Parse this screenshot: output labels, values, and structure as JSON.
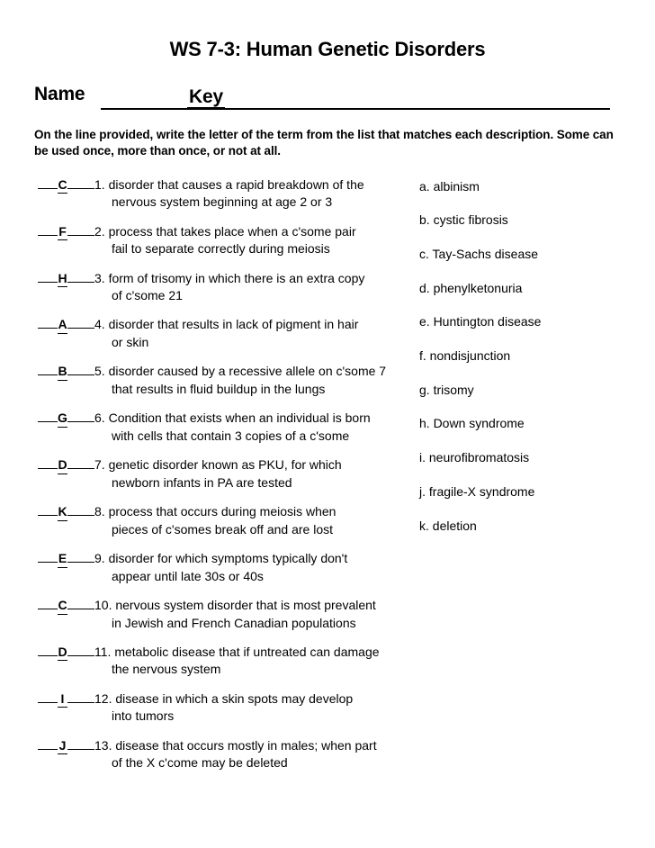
{
  "document": {
    "title": "WS 7-3: Human Genetic Disorders",
    "name_label": "Name",
    "name_value": "Key",
    "instructions": "On the line provided, write the letter of the term from the list that matches each description. Some can be used once, more than once, or not at all."
  },
  "questions": [
    {
      "number": "1.",
      "answer": "C",
      "line1": "disorder that causes a rapid breakdown of the",
      "line2": "nervous system beginning at age 2 or 3"
    },
    {
      "number": "2.",
      "answer": "F",
      "line1": "process that takes place when a c'some pair",
      "line2": "fail to separate correctly during meiosis"
    },
    {
      "number": "3.",
      "answer": "H",
      "line1": "form of trisomy in which there is an extra copy",
      "line2": "of c'some 21"
    },
    {
      "number": "4.",
      "answer": "A",
      "line1": "disorder that results in lack of pigment in hair",
      "line2": "or skin"
    },
    {
      "number": "5.",
      "answer": "B",
      "line1": "disorder caused by a recessive allele on c'some 7",
      "line2": "that results in fluid buildup in the lungs"
    },
    {
      "number": "6.",
      "answer": "G",
      "line1": "Condition that exists when an individual is born",
      "line2": "with cells that contain 3 copies of a c'some"
    },
    {
      "number": "7.",
      "answer": "D",
      "line1": "genetic disorder known as PKU, for which",
      "line2": "newborn infants in PA are tested"
    },
    {
      "number": "8.",
      "answer": "K",
      "line1": "process that occurs during meiosis when",
      "line2": "pieces of c'somes break off and are lost"
    },
    {
      "number": "9.",
      "answer": "E",
      "line1": "disorder for which symptoms typically don't",
      "line2": "appear until late 30s or 40s"
    },
    {
      "number": "10.",
      "answer": "C",
      "line1": "nervous system disorder that is most prevalent",
      "line2": "in Jewish and French Canadian populations"
    },
    {
      "number": "11.",
      "answer": "D",
      "line1": "metabolic disease that if untreated can damage",
      "line2": "the nervous system"
    },
    {
      "number": "12.",
      "answer": "I",
      "line1": "disease in which a skin spots may develop",
      "line2": "into tumors"
    },
    {
      "number": "13.",
      "answer": "J",
      "line1": "disease that occurs mostly in males; when part",
      "line2": "of the X c'come may be deleted"
    }
  ],
  "answer_bank": [
    {
      "label": "a. albinism"
    },
    {
      "label": "b. cystic fibrosis"
    },
    {
      "label": "c. Tay-Sachs disease"
    },
    {
      "label": "d. phenylketonuria"
    },
    {
      "label": "e. Huntington disease"
    },
    {
      "label": "f. nondisjunction"
    },
    {
      "label": "g. trisomy"
    },
    {
      "label": "h. Down syndrome"
    },
    {
      "label": "i. neurofibromatosis"
    },
    {
      "label": "j. fragile-X syndrome"
    },
    {
      "label": "k. deletion"
    }
  ]
}
